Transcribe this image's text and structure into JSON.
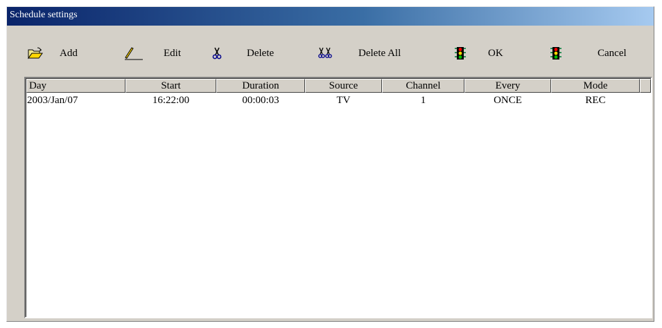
{
  "window": {
    "title": "Schedule settings"
  },
  "toolbar": {
    "add_label": "Add",
    "edit_label": "Edit",
    "delete_label": "Delete",
    "delete_all_label": "Delete All",
    "ok_label": "OK",
    "cancel_label": "Cancel"
  },
  "icons": {
    "add": "open-folder-icon",
    "edit": "pencil-icon",
    "delete": "scissors-icon",
    "delete_all": "double-scissors-icon",
    "ok": "traffic-light-icon",
    "cancel": "traffic-light-icon"
  },
  "table": {
    "columns": [
      "Day",
      "Start",
      "Duration",
      "Source",
      "Channel",
      "Every",
      "Mode"
    ],
    "rows": [
      [
        "2003/Jan/07",
        "16:22:00",
        "00:00:03",
        "TV",
        "1",
        "ONCE",
        "REC"
      ]
    ]
  },
  "colors": {
    "title_gradient_start": "#0a246a",
    "title_gradient_end": "#a6caf0",
    "face": "#d4d0c8"
  }
}
